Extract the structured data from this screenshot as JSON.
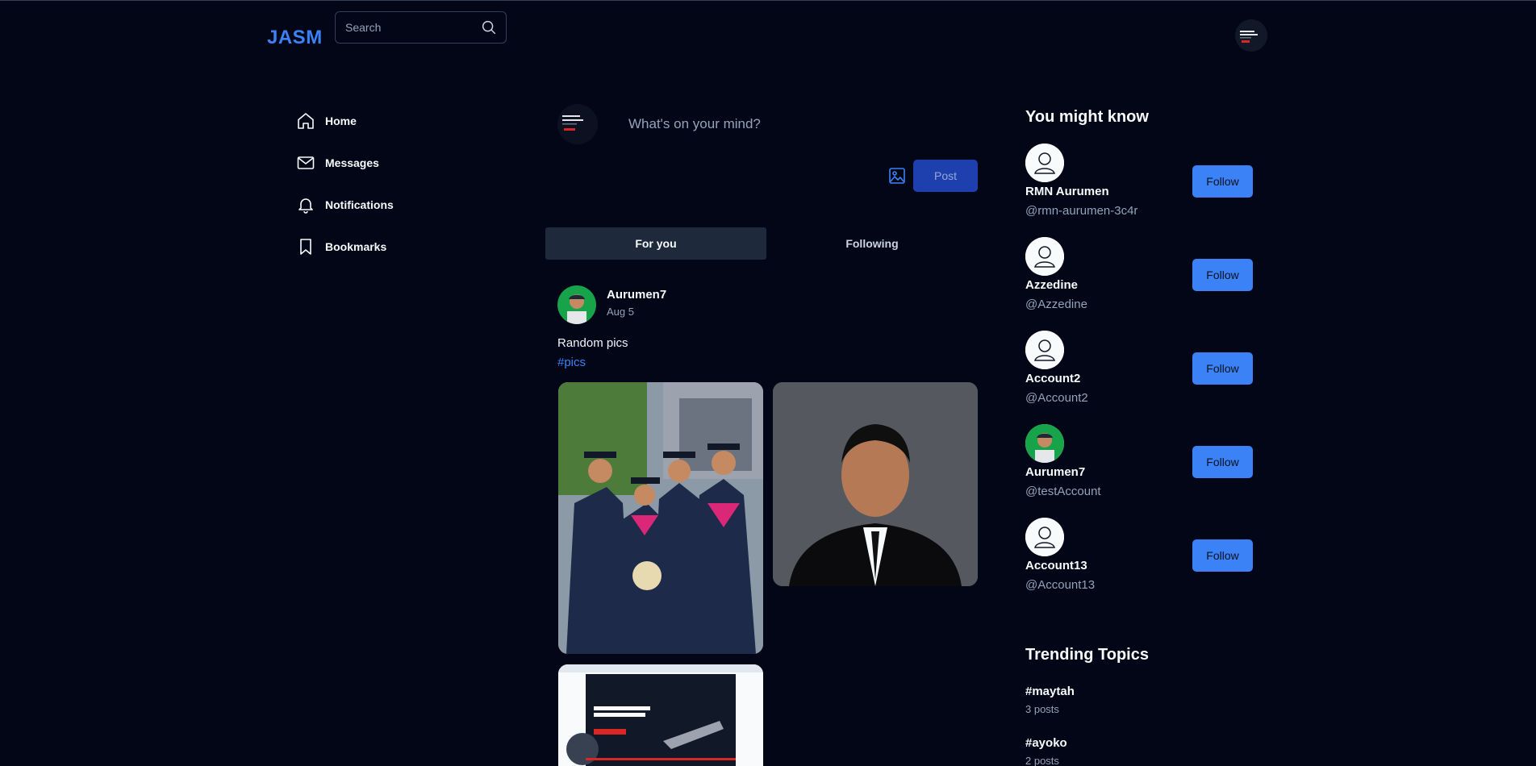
{
  "header": {
    "logo": "JASM",
    "search_placeholder": "Search",
    "search_icon": "search-icon"
  },
  "nav": [
    {
      "label": "Home",
      "icon": "home-icon"
    },
    {
      "label": "Messages",
      "icon": "mail-icon"
    },
    {
      "label": "Notifications",
      "icon": "bell-icon"
    },
    {
      "label": "Bookmarks",
      "icon": "bookmark-icon"
    }
  ],
  "composer": {
    "placeholder": "What's on your mind?",
    "post_label": "Post",
    "image_icon": "image-icon"
  },
  "tabs": {
    "active": "For you",
    "inactive": "Following"
  },
  "post": {
    "author": "Aurumen7",
    "date": "Aug 5",
    "text": "Random pics",
    "hashtag": "#pics"
  },
  "suggestions": {
    "title": "You might know",
    "follow_label": "Follow",
    "people": [
      {
        "name": "RMN Aurumen",
        "handle": "@rmn-aurumen-3c4r"
      },
      {
        "name": "Azzedine",
        "handle": "@Azzedine"
      },
      {
        "name": "Account2",
        "handle": "@Account2"
      },
      {
        "name": "Aurumen7",
        "handle": "@testAccount"
      },
      {
        "name": "Account13",
        "handle": "@Account13"
      }
    ]
  },
  "trending": {
    "title": "Trending Topics",
    "topics": [
      {
        "tag": "#maytah",
        "count": "3 posts"
      },
      {
        "tag": "#ayoko",
        "count": "2 posts"
      }
    ]
  },
  "colors": {
    "background": "#020617",
    "accent": "#3b82f6",
    "post_button": "#1e40af",
    "tab_active": "#1e293b"
  }
}
